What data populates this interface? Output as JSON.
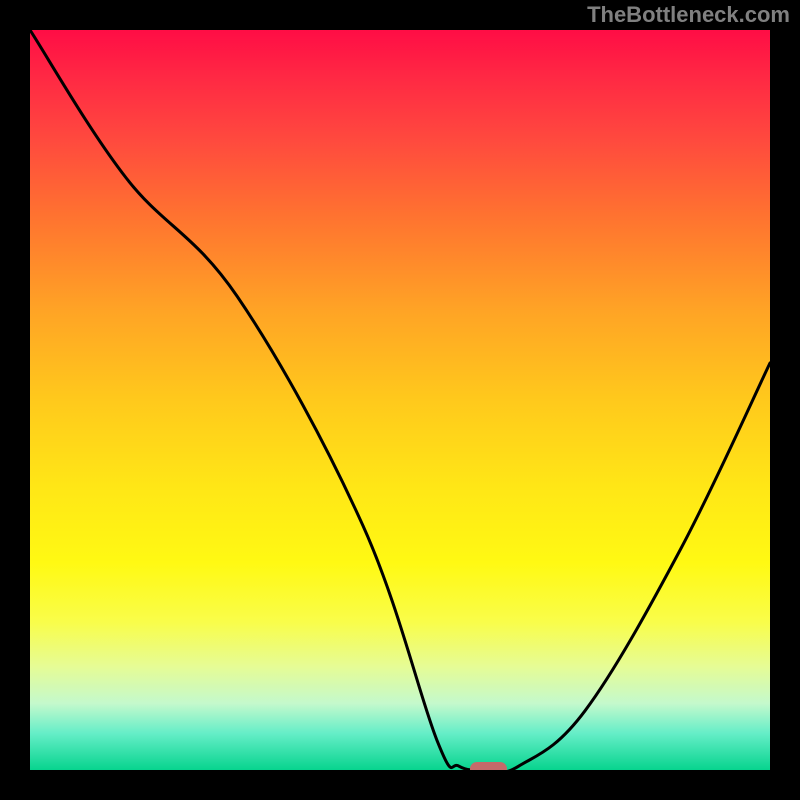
{
  "watermark": "TheBottleneck.com",
  "chart_data": {
    "type": "line",
    "title": "",
    "xlabel": "",
    "ylabel": "",
    "xlim": [
      0,
      100
    ],
    "ylim": [
      0,
      100
    ],
    "series": [
      {
        "name": "bottleneck-curve",
        "x": [
          0,
          13,
          28,
          45,
          55,
          58,
          62,
          66,
          75,
          88,
          100
        ],
        "values": [
          100,
          80,
          64,
          33,
          4,
          0.5,
          0,
          0.5,
          8,
          30,
          55
        ]
      }
    ],
    "marker": {
      "x": 62,
      "y": 0,
      "width_pct": 5,
      "height_pct": 2
    },
    "gradient_colors": {
      "top": "#ff0d45",
      "mid": "#ffe716",
      "bottom": "#07d48e"
    }
  }
}
